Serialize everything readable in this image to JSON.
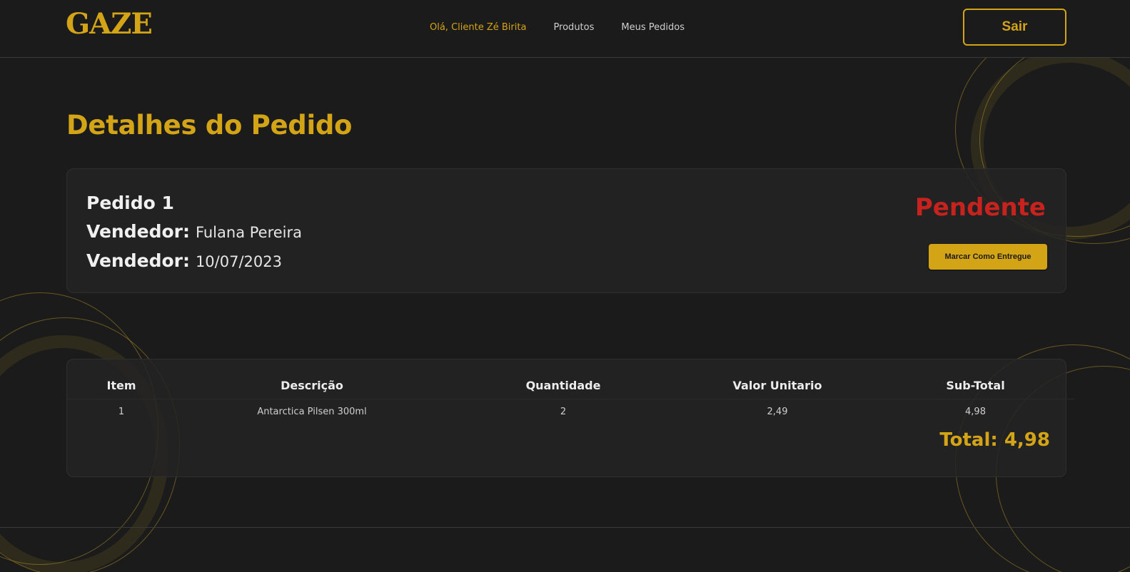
{
  "brand": {
    "logo": "GAZE",
    "accent": "#d4a417"
  },
  "nav": {
    "greeting": "Olá, Cliente Zé Birita",
    "links": [
      "Produtos",
      "Meus Pedidos"
    ],
    "logout_label": "Sair"
  },
  "page_title": "Detalhes do Pedido",
  "order": {
    "title": "Pedido 1",
    "seller_label": "Vendedor:",
    "seller_value": "Fulana Pereira",
    "date_label": "Vendedor:",
    "date_value": "10/07/2023",
    "status": "Pendente",
    "status_color": "#c8221e",
    "action_label": "Marcar Como Entregue"
  },
  "items_table": {
    "headers": [
      "Item",
      "Descrição",
      "Quantidade",
      "Valor Unitario",
      "Sub-Total"
    ],
    "rows": [
      {
        "item": "1",
        "description": "Antarctica Pilsen 300ml",
        "quantity": "2",
        "unit_price": "2,49",
        "subtotal": "4,98"
      }
    ],
    "total": "Total: 4,98"
  }
}
